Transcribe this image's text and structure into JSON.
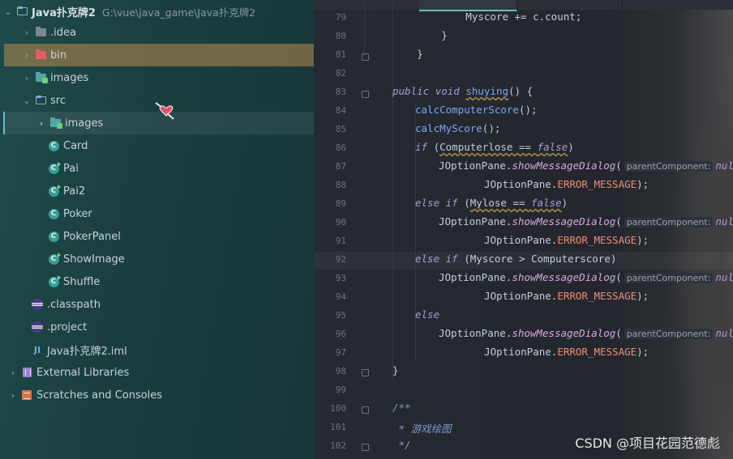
{
  "project": {
    "root_name": "Java扑克牌2",
    "root_path": "G:\\vue\\java_game\\Java扑克牌2",
    "items": [
      {
        "label": "Java扑克牌2",
        "icon": "folder-icon"
      },
      {
        "label": ".idea",
        "icon": "folder-icon"
      },
      {
        "label": "bin",
        "icon": "excluded-folder-icon"
      },
      {
        "label": "images",
        "icon": "resource-folder-icon"
      },
      {
        "label": "src",
        "icon": "source-folder-icon"
      },
      {
        "label": "images",
        "icon": "resource-folder-icon"
      },
      {
        "label": "Card",
        "icon": "class-icon"
      },
      {
        "label": "Pai",
        "icon": "main-class-icon"
      },
      {
        "label": "Pai2",
        "icon": "main-class-icon"
      },
      {
        "label": "Poker",
        "icon": "class-icon"
      },
      {
        "label": "PokerPanel",
        "icon": "class-icon"
      },
      {
        "label": "ShowImage",
        "icon": "main-class-icon"
      },
      {
        "label": "Shuffle",
        "icon": "main-class-icon"
      },
      {
        "label": ".classpath",
        "icon": "eclipse-icon"
      },
      {
        "label": ".project",
        "icon": "eclipse-icon"
      },
      {
        "label": "Java扑克牌2.iml",
        "icon": "module-file-icon"
      },
      {
        "label": "External Libraries",
        "icon": "library-icon"
      },
      {
        "label": "Scratches and Consoles",
        "icon": "scratches-icon"
      }
    ]
  },
  "editor": {
    "lines": [
      {
        "n": "79",
        "t": "            Myscore += c.count;"
      },
      {
        "n": "80",
        "t": "        }"
      },
      {
        "n": "81",
        "t": "    }"
      },
      {
        "n": "82",
        "t": ""
      },
      {
        "n": "83",
        "t": "public void shuying() {"
      },
      {
        "n": "84",
        "t": "calcComputerScore();"
      },
      {
        "n": "85",
        "t": "calcMyScore();"
      },
      {
        "n": "86",
        "t": "if (Computerlose == false)"
      },
      {
        "n": "87",
        "t": "JOptionPane.showMessageDialog("
      },
      {
        "n": "88",
        "t": "JOptionPane.ERROR_MESSAGE);"
      },
      {
        "n": "89",
        "t": "else if (Mylose == false)"
      },
      {
        "n": "90",
        "t": "JOptionPane.showMessageDialog("
      },
      {
        "n": "91",
        "t": "JOptionPane.ERROR_MESSAGE);"
      },
      {
        "n": "92",
        "t": "else if (Myscore > Computerscore)"
      },
      {
        "n": "93",
        "t": "JOptionPane.showMessageDialog("
      },
      {
        "n": "94",
        "t": "JOptionPane.ERROR_MESSAGE);"
      },
      {
        "n": "95",
        "t": "else"
      },
      {
        "n": "96",
        "t": "JOptionPane.showMessageDialog("
      },
      {
        "n": "97",
        "t": "JOptionPane.ERROR_MESSAGE);"
      },
      {
        "n": "98",
        "t": "}"
      },
      {
        "n": "99",
        "t": ""
      },
      {
        "n": "100",
        "t": "/**"
      },
      {
        "n": "101",
        "t": " * 游戏绘图"
      },
      {
        "n": "102",
        "t": " */"
      }
    ],
    "hint_label": "parentComponent:",
    "null_kw": "null,"
  },
  "watermark": "CSDN @项目花园范德彪",
  "colors": {
    "selection": "#b88c4e",
    "keyword": "#b09ad8",
    "method": "#7aa8ef",
    "constant": "#ef8d7a"
  }
}
